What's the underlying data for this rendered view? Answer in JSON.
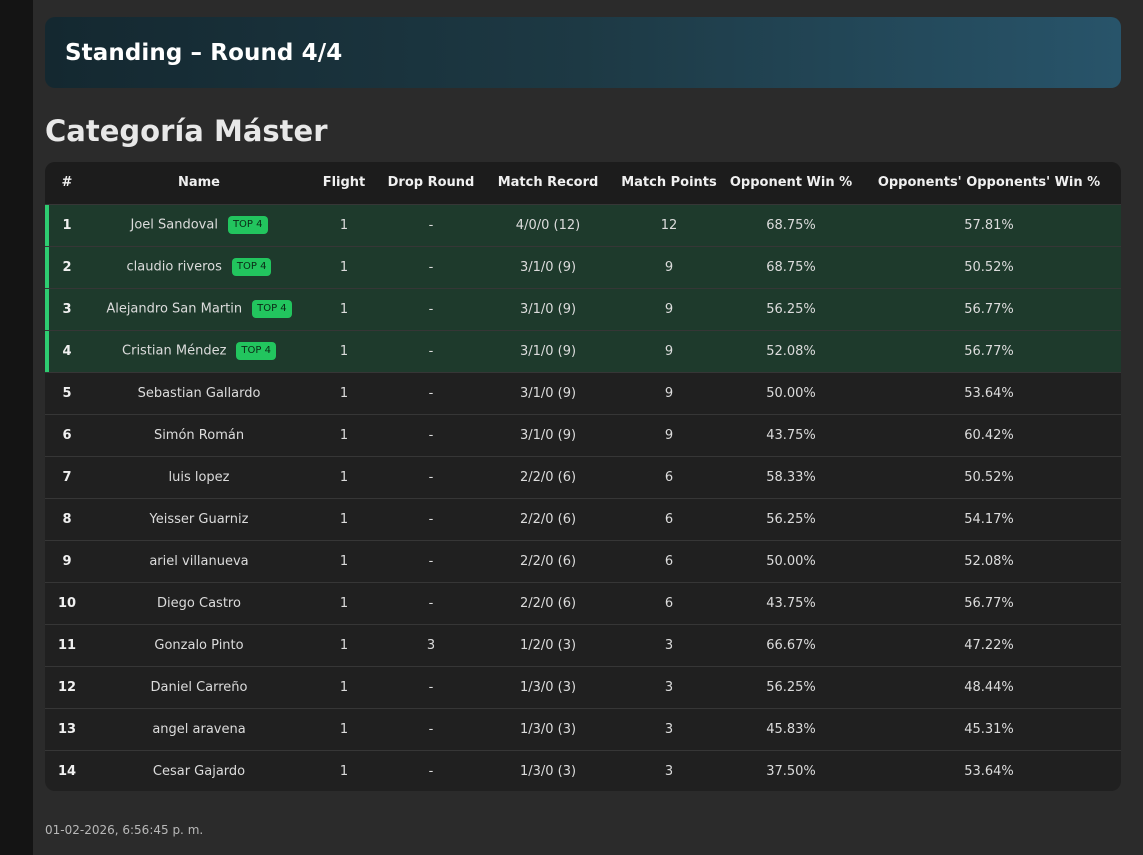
{
  "header": {
    "title": "Standing – Round 4/4"
  },
  "category": {
    "title": "Categoría Máster"
  },
  "table": {
    "columns": [
      "#",
      "Name",
      "Flight",
      "Drop Round",
      "Match Record",
      "Match Points",
      "Opponent Win %",
      "Opponents' Opponents' Win %"
    ],
    "badge_label": "TOP 4",
    "rows": [
      {
        "rank": "1",
        "name": "Joel Sandoval",
        "top": true,
        "flight": "1",
        "drop": "-",
        "record": "4/0/0 (12)",
        "points": "12",
        "owp": "68.75%",
        "oowp": "57.81%"
      },
      {
        "rank": "2",
        "name": "claudio riveros",
        "top": true,
        "flight": "1",
        "drop": "-",
        "record": "3/1/0 (9)",
        "points": "9",
        "owp": "68.75%",
        "oowp": "50.52%"
      },
      {
        "rank": "3",
        "name": "Alejandro San Martin",
        "top": true,
        "flight": "1",
        "drop": "-",
        "record": "3/1/0 (9)",
        "points": "9",
        "owp": "56.25%",
        "oowp": "56.77%"
      },
      {
        "rank": "4",
        "name": "Cristian Méndez",
        "top": true,
        "flight": "1",
        "drop": "-",
        "record": "3/1/0 (9)",
        "points": "9",
        "owp": "52.08%",
        "oowp": "56.77%"
      },
      {
        "rank": "5",
        "name": "Sebastian Gallardo",
        "top": false,
        "flight": "1",
        "drop": "-",
        "record": "3/1/0 (9)",
        "points": "9",
        "owp": "50.00%",
        "oowp": "53.64%"
      },
      {
        "rank": "6",
        "name": "Simón Román",
        "top": false,
        "flight": "1",
        "drop": "-",
        "record": "3/1/0 (9)",
        "points": "9",
        "owp": "43.75%",
        "oowp": "60.42%"
      },
      {
        "rank": "7",
        "name": "luis lopez",
        "top": false,
        "flight": "1",
        "drop": "-",
        "record": "2/2/0 (6)",
        "points": "6",
        "owp": "58.33%",
        "oowp": "50.52%"
      },
      {
        "rank": "8",
        "name": "Yeisser Guarniz",
        "top": false,
        "flight": "1",
        "drop": "-",
        "record": "2/2/0 (6)",
        "points": "6",
        "owp": "56.25%",
        "oowp": "54.17%"
      },
      {
        "rank": "9",
        "name": "ariel villanueva",
        "top": false,
        "flight": "1",
        "drop": "-",
        "record": "2/2/0 (6)",
        "points": "6",
        "owp": "50.00%",
        "oowp": "52.08%"
      },
      {
        "rank": "10",
        "name": "Diego Castro",
        "top": false,
        "flight": "1",
        "drop": "-",
        "record": "2/2/0 (6)",
        "points": "6",
        "owp": "43.75%",
        "oowp": "56.77%"
      },
      {
        "rank": "11",
        "name": "Gonzalo Pinto",
        "top": false,
        "flight": "1",
        "drop": "3",
        "record": "1/2/0 (3)",
        "points": "3",
        "owp": "66.67%",
        "oowp": "47.22%"
      },
      {
        "rank": "12",
        "name": "Daniel Carreño",
        "top": false,
        "flight": "1",
        "drop": "-",
        "record": "1/3/0 (3)",
        "points": "3",
        "owp": "56.25%",
        "oowp": "48.44%"
      },
      {
        "rank": "13",
        "name": "angel aravena",
        "top": false,
        "flight": "1",
        "drop": "-",
        "record": "1/3/0 (3)",
        "points": "3",
        "owp": "45.83%",
        "oowp": "45.31%"
      },
      {
        "rank": "14",
        "name": "Cesar Gajardo",
        "top": false,
        "flight": "1",
        "drop": "-",
        "record": "1/3/0 (3)",
        "points": "3",
        "owp": "37.50%",
        "oowp": "53.64%"
      }
    ]
  },
  "footer": {
    "timestamp": "01-02-2026, 6:56:45 p. m."
  },
  "colors": {
    "top_highlight": "#1e3a2c",
    "top_accent": "#2ecc71",
    "badge": "#22c55e"
  }
}
